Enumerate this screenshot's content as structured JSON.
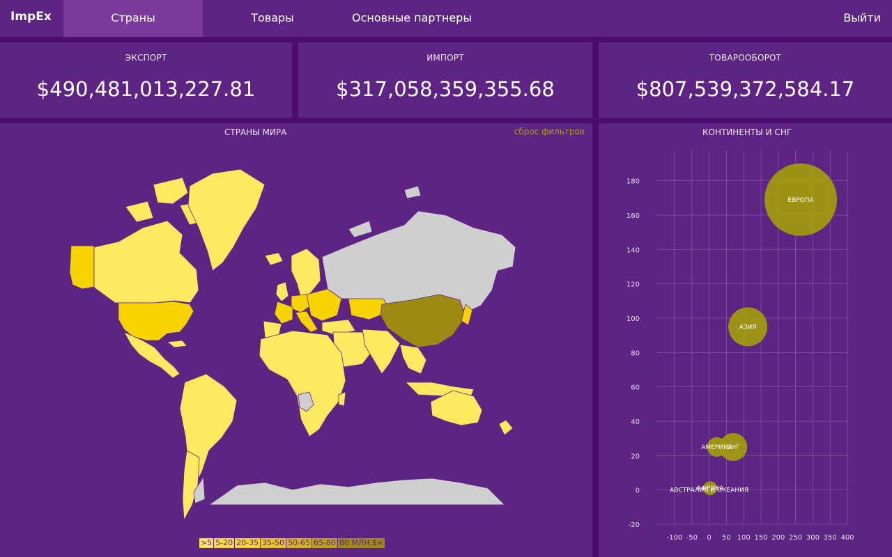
{
  "app": {
    "brand": "ImpEx"
  },
  "nav": {
    "items": [
      {
        "label": "Страны",
        "active": true
      },
      {
        "label": "Товары",
        "active": false
      },
      {
        "label": "Основные партнеры",
        "active": false
      }
    ],
    "logout": "Выйти"
  },
  "kpis": {
    "export": {
      "title": "ЭКСПОРТ",
      "value": "$490,481,013,227.81"
    },
    "import": {
      "title": "ИМПОРТ",
      "value": "$317,058,359,355.68"
    },
    "turnover": {
      "title": "ТОВАРООБОРОТ",
      "value": "$807,539,372,584.17"
    }
  },
  "map_panel": {
    "title": "СТРАНЫ МИРА",
    "reset": "сброс фильтров",
    "legend": [
      {
        "label": ">5",
        "color": "#fde25f"
      },
      {
        "label": "5-20",
        "color": "#f9dc3c"
      },
      {
        "label": "20-35",
        "color": "#f4d626"
      },
      {
        "label": "35-50",
        "color": "#e8c51a"
      },
      {
        "label": "50-65",
        "color": "#d6b416"
      },
      {
        "label": "65-80",
        "color": "#b9a015"
      },
      {
        "label": "80 МЛН.$<",
        "color": "#9c8a12"
      }
    ]
  },
  "bubble_panel": {
    "title": "КОНТИНЕНТЫ И СНГ"
  },
  "colors": {
    "background": "#4a0f6e",
    "panel": "#5e2484",
    "nav_active": "#7a3a9c",
    "bubble": "#9f9a10",
    "country_light": "#fce95f",
    "country_gold": "#f7d300",
    "country_dark": "#9c8a12",
    "country_gray": "#cfcfcf"
  },
  "chart_data": {
    "type": "scatter",
    "title": "КОНТИНЕНТЫ И СНГ",
    "xlim": [
      -100,
      400
    ],
    "ylim": [
      -20,
      190
    ],
    "xticks": [
      -100,
      -50,
      0,
      50,
      100,
      150,
      200,
      250,
      300,
      350,
      400
    ],
    "yticks": [
      -20,
      0,
      20,
      40,
      60,
      80,
      100,
      120,
      140,
      160,
      180
    ],
    "points": [
      {
        "label": "ЕВРОПА",
        "x": 265,
        "y": 169,
        "size": 52
      },
      {
        "label": "АЗИЯ",
        "x": 112,
        "y": 95,
        "size": 28
      },
      {
        "label": "СНГ",
        "x": 70,
        "y": 25,
        "size": 20
      },
      {
        "label": "АМЕРИКА",
        "x": 22,
        "y": 25,
        "size": 14
      },
      {
        "label": "АФРИКА",
        "x": 3,
        "y": 1,
        "size": 10
      },
      {
        "label": "АВСТРАЛИЯ И ОКЕАНИЯ",
        "x": 0,
        "y": 0,
        "size": 3
      }
    ],
    "grid": true
  }
}
